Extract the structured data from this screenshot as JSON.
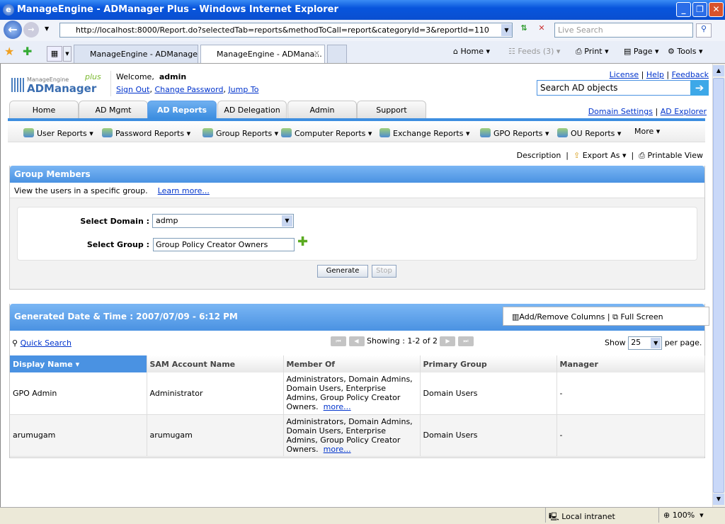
{
  "window": {
    "title": "ManageEngine - ADManager Plus - Windows Internet Explorer"
  },
  "browser": {
    "url": "http://localhost:8000/Report.do?selectedTab=reports&methodToCall=report&categoryId=3&reportId=110",
    "search_placeholder": "Live Search",
    "tabs": [
      {
        "label": "ManageEngine - ADManager ..."
      },
      {
        "label": "ManageEngine - ADMana..."
      }
    ],
    "commands": {
      "home": "Home",
      "feeds": "Feeds (3)",
      "print": "Print",
      "page": "Page",
      "tools": "Tools"
    },
    "status": {
      "zone": "Local intranet",
      "zoom": "100%"
    }
  },
  "header": {
    "logo_top": "ManageEngine",
    "logo_main": "ADManager",
    "logo_plus": "plus",
    "welcome": "Welcome,",
    "user": "admin",
    "links": [
      "Sign Out",
      "Change Password",
      "Jump To"
    ],
    "top_links": [
      "License",
      "Help",
      "Feedback"
    ],
    "search_placeholder": "Search AD objects",
    "right_links": [
      "Domain Settings",
      "AD Explorer"
    ]
  },
  "tabs": [
    {
      "label": "Home"
    },
    {
      "label": "AD Mgmt"
    },
    {
      "label": "AD Reports",
      "active": true
    },
    {
      "label": "AD Delegation"
    },
    {
      "label": "Admin"
    },
    {
      "label": "Support"
    }
  ],
  "menu": [
    "User Reports",
    "Password Reports",
    "Group Reports",
    "Computer Reports",
    "Exchange Reports",
    "GPO Reports",
    "OU Reports",
    "More"
  ],
  "actions": {
    "description": "Description",
    "export": "Export As",
    "printable": "Printable View"
  },
  "group_members": {
    "title": "Group Members",
    "desc": "View the users in a specific group.",
    "learn_more": "Learn more...",
    "domain_label": "Select Domain :",
    "domain_value": "admp",
    "group_label": "Select Group :",
    "group_value": "Group Policy Creator Owners",
    "generate": "Generate",
    "stop": "Stop"
  },
  "report": {
    "title": "Generated Date & Time : 2007/07/09 - 6:12 PM",
    "add_remove": "Add/Remove Columns",
    "full_screen": "Full Screen",
    "quick_search": "Quick Search",
    "showing": "Showing : 1-2 of 2",
    "show": "Show",
    "per_page_value": "25",
    "per_page": "per page.",
    "columns": [
      "Display Name",
      "SAM Account Name",
      "Member Of",
      "Primary Group",
      "Manager"
    ],
    "rows": [
      {
        "display": "GPO Admin",
        "sam": "Administrator",
        "member_of": "Administrators, Domain Admins, Domain Users, Enterprise Admins, Group Policy Creator Owners.",
        "more": "more...",
        "primary": "Domain Users",
        "manager": "-"
      },
      {
        "display": "arumugam",
        "sam": "arumugam",
        "member_of": "Administrators, Domain Admins, Domain Users, Enterprise Admins, Group Policy Creator Owners.",
        "more": "more...",
        "primary": "Domain Users",
        "manager": "-"
      }
    ]
  }
}
